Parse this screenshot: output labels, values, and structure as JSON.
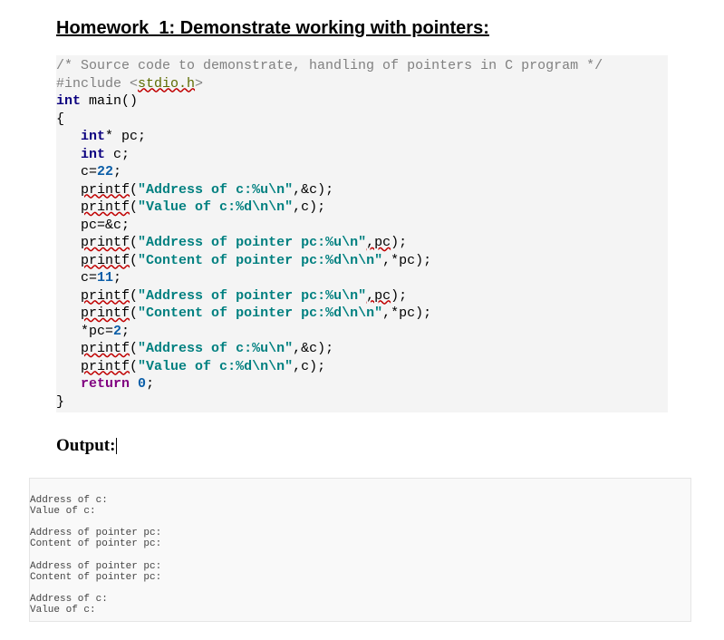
{
  "title": "Homework_1: Demonstrate working with pointers:",
  "code": {
    "comment": "/* Source code to demonstrate, handling of pointers in C program */",
    "include_kw": "#include ",
    "include_lt": "<",
    "include_hdr": "stdio.h",
    "include_gt": ">",
    "kw_int": "int",
    "main_sig": " main()",
    "brace_open": "{",
    "star_pc": "* pc;",
    "c_decl": " c;",
    "c_eq": "c=",
    "n22": "22",
    "semi": ";",
    "printf": "printf",
    "lparen": "(",
    "s_addr_c": "\"Address of c:%u\\n\"",
    "arg_ampc": ",&c);",
    "s_val_c": "\"Value of c:%d\\n\\n\"",
    "arg_c": ",c);",
    "pc_ampc": "pc=&c;",
    "s_addr_pc": "\"Address of pointer pc:%u\\n\"",
    "arg_pc_err": ",pc",
    "arg_pc_close": ");",
    "s_cont_pc": "\"Content of pointer pc:%d\\n\\n\"",
    "arg_starpc": ",*pc);",
    "n11": "11",
    "starpc_eq": "*pc=",
    "n2": "2",
    "kw_return": "return",
    "n0": "0",
    "brace_close": "}"
  },
  "output_heading": "Output:",
  "output_lines": {
    "addr_c": "Address of c:",
    "val_c": "Value of c:",
    "addr_pc": "Address of pointer pc:",
    "cont_pc": "Content of pointer pc:"
  }
}
